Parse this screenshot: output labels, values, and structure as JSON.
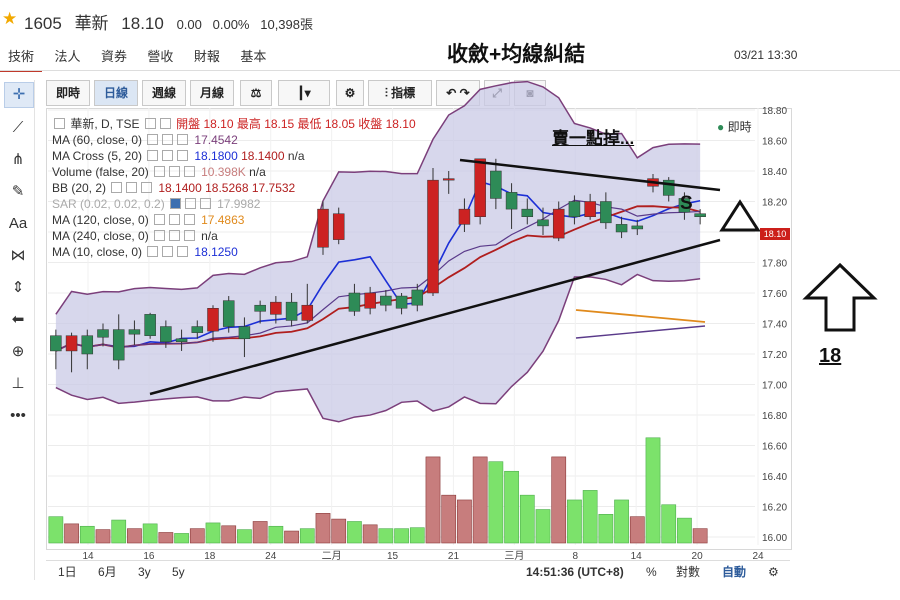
{
  "header": {
    "code": "1605",
    "name": "華新",
    "price": "18.10",
    "change": "0.00",
    "change_pct": "0.00%",
    "volume": "10,398張"
  },
  "nav": {
    "tabs": [
      "技術",
      "法人",
      "資券",
      "營收",
      "財報",
      "基本"
    ]
  },
  "annotation_title": "收斂+均線糾結",
  "datetime": "03/21 13:30",
  "toolbar": {
    "buttons": [
      "即時",
      "日線",
      "週線",
      "月線",
      "指標"
    ]
  },
  "live_label": "即時",
  "legend": {
    "main": "華新, D, TSE",
    "ohlc": "開盤 18.10 最高 18.15 最低 18.05 收盤 18.10",
    "ma60": {
      "label": "MA (60, close, 0)",
      "value": "17.4542"
    },
    "macross": {
      "label": "MA Cross (5, 20)",
      "v1": "18.1800",
      "v2": "18.1400",
      "v3": "n/a"
    },
    "volume": {
      "label": "Volume (false, 20)",
      "v1": "10.398K",
      "v2": "n/a"
    },
    "bb": {
      "label": "BB (20, 2)",
      "v1": "18.1400",
      "v2": "18.5268",
      "v3": "17.7532"
    },
    "sar": {
      "label": "SAR (0.02, 0.02, 0.2)",
      "value": "17.9982"
    },
    "ma120": {
      "label": "MA (120, close, 0)",
      "value": "17.4863"
    },
    "ma240": {
      "label": "MA (240, close, 0)",
      "value": "n/a"
    },
    "ma10": {
      "label": "MA (10, close, 0)",
      "value": "18.1250"
    }
  },
  "annotations": {
    "sell": "賣一點掉...",
    "s": "S",
    "target": "18"
  },
  "price_tag": "18.10",
  "bottom": {
    "ranges": [
      "1日",
      "6月",
      "3y",
      "5y"
    ],
    "time": "14:51:36 (UTC+8)",
    "pct": "%",
    "log": "對數",
    "auto": "自動"
  },
  "colors": {
    "up": "#cc2222",
    "down": "#2e8b57",
    "bb_band": "#7b3f7b",
    "ma_blue": "#1c2fd6",
    "ma_red": "#b01e1e",
    "vol_up": "#c77d7d",
    "vol_down": "#7ce26b"
  },
  "chart_data": {
    "type": "candlestick",
    "y_range": [
      16.0,
      18.8
    ],
    "y_ticks": [
      "18.80",
      "18.60",
      "18.40",
      "18.20",
      "18.00",
      "17.80",
      "17.60",
      "17.40",
      "17.20",
      "17.00",
      "16.80",
      "16.60",
      "16.40",
      "16.20",
      "16.00"
    ],
    "x_ticks": [
      "14",
      "16",
      "18",
      "24",
      "二月",
      "15",
      "21",
      "三月",
      "8",
      "14",
      "20",
      "24"
    ],
    "candles": [
      {
        "o": 17.32,
        "c": 17.22,
        "h": 17.36,
        "l": 17.1
      },
      {
        "o": 17.22,
        "c": 17.32,
        "h": 17.34,
        "l": 17.08
      },
      {
        "o": 17.32,
        "c": 17.2,
        "h": 17.36,
        "l": 17.1
      },
      {
        "o": 17.36,
        "c": 17.31,
        "h": 17.4,
        "l": 17.25
      },
      {
        "o": 17.36,
        "c": 17.16,
        "h": 17.46,
        "l": 17.1
      },
      {
        "o": 17.36,
        "c": 17.33,
        "h": 17.42,
        "l": 17.26
      },
      {
        "o": 17.46,
        "c": 17.32,
        "h": 17.47,
        "l": 17.3
      },
      {
        "o": 17.38,
        "c": 17.28,
        "h": 17.42,
        "l": 17.24
      },
      {
        "o": 17.3,
        "c": 17.28,
        "h": 17.36,
        "l": 17.22
      },
      {
        "o": 17.38,
        "c": 17.34,
        "h": 17.42,
        "l": 17.3
      },
      {
        "o": 17.35,
        "c": 17.5,
        "h": 17.52,
        "l": 17.28
      },
      {
        "o": 17.55,
        "c": 17.38,
        "h": 17.58,
        "l": 17.34
      },
      {
        "o": 17.38,
        "c": 17.3,
        "h": 17.44,
        "l": 17.18
      },
      {
        "o": 17.52,
        "c": 17.48,
        "h": 17.55,
        "l": 17.4
      },
      {
        "o": 17.46,
        "c": 17.54,
        "h": 17.58,
        "l": 17.4
      },
      {
        "o": 17.54,
        "c": 17.42,
        "h": 17.6,
        "l": 17.38
      },
      {
        "o": 17.42,
        "c": 17.52,
        "h": 17.66,
        "l": 17.4
      },
      {
        "o": 17.9,
        "c": 18.15,
        "h": 18.2,
        "l": 17.85
      },
      {
        "o": 17.95,
        "c": 18.12,
        "h": 18.16,
        "l": 17.92
      },
      {
        "o": 17.6,
        "c": 17.48,
        "h": 17.66,
        "l": 17.45
      },
      {
        "o": 17.5,
        "c": 17.6,
        "h": 17.64,
        "l": 17.46
      },
      {
        "o": 17.58,
        "c": 17.52,
        "h": 17.62,
        "l": 17.48
      },
      {
        "o": 17.58,
        "c": 17.5,
        "h": 17.6,
        "l": 17.46
      },
      {
        "o": 17.62,
        "c": 17.52,
        "h": 17.66,
        "l": 17.48
      },
      {
        "o": 17.6,
        "c": 18.34,
        "h": 18.42,
        "l": 17.58
      },
      {
        "o": 18.34,
        "c": 18.35,
        "h": 18.4,
        "l": 18.25
      },
      {
        "o": 18.05,
        "c": 18.15,
        "h": 18.22,
        "l": 18.0
      },
      {
        "o": 18.1,
        "c": 18.48,
        "h": 18.48,
        "l": 18.05
      },
      {
        "o": 18.4,
        "c": 18.22,
        "h": 18.48,
        "l": 18.15
      },
      {
        "o": 18.26,
        "c": 18.15,
        "h": 18.32,
        "l": 18.02
      },
      {
        "o": 18.15,
        "c": 18.1,
        "h": 18.22,
        "l": 18.05
      },
      {
        "o": 18.08,
        "c": 18.04,
        "h": 18.16,
        "l": 17.98
      },
      {
        "o": 17.96,
        "c": 18.15,
        "h": 18.2,
        "l": 17.94
      },
      {
        "o": 18.2,
        "c": 18.1,
        "h": 18.24,
        "l": 18.05
      },
      {
        "o": 18.1,
        "c": 18.2,
        "h": 18.25,
        "l": 18.08
      },
      {
        "o": 18.2,
        "c": 18.06,
        "h": 18.26,
        "l": 18.02
      },
      {
        "o": 18.05,
        "c": 18.0,
        "h": 18.1,
        "l": 17.96
      },
      {
        "o": 18.04,
        "c": 18.02,
        "h": 18.08,
        "l": 17.98
      },
      {
        "o": 18.3,
        "c": 18.35,
        "h": 18.38,
        "l": 18.26
      },
      {
        "o": 18.34,
        "c": 18.24,
        "h": 18.36,
        "l": 18.2
      },
      {
        "o": 18.22,
        "c": 18.13,
        "h": 18.26,
        "l": 18.08
      },
      {
        "o": 18.12,
        "c": 18.1,
        "h": 18.15,
        "l": 18.05
      }
    ],
    "volume": [
      {
        "v": 0.55,
        "up": false
      },
      {
        "v": 0.4,
        "up": true
      },
      {
        "v": 0.35,
        "up": false
      },
      {
        "v": 0.28,
        "up": true
      },
      {
        "v": 0.48,
        "up": false
      },
      {
        "v": 0.3,
        "up": true
      },
      {
        "v": 0.4,
        "up": false
      },
      {
        "v": 0.22,
        "up": true
      },
      {
        "v": 0.2,
        "up": false
      },
      {
        "v": 0.3,
        "up": true
      },
      {
        "v": 0.42,
        "up": false
      },
      {
        "v": 0.36,
        "up": true
      },
      {
        "v": 0.28,
        "up": false
      },
      {
        "v": 0.45,
        "up": true
      },
      {
        "v": 0.35,
        "up": false
      },
      {
        "v": 0.25,
        "up": true
      },
      {
        "v": 0.3,
        "up": false
      },
      {
        "v": 0.62,
        "up": true
      },
      {
        "v": 0.5,
        "up": true
      },
      {
        "v": 0.45,
        "up": false
      },
      {
        "v": 0.38,
        "up": true
      },
      {
        "v": 0.3,
        "up": false
      },
      {
        "v": 0.3,
        "up": false
      },
      {
        "v": 0.32,
        "up": false
      },
      {
        "v": 1.8,
        "up": true
      },
      {
        "v": 1.0,
        "up": true
      },
      {
        "v": 0.9,
        "up": true
      },
      {
        "v": 1.8,
        "up": true
      },
      {
        "v": 1.7,
        "up": false
      },
      {
        "v": 1.5,
        "up": false
      },
      {
        "v": 1.0,
        "up": false
      },
      {
        "v": 0.7,
        "up": false
      },
      {
        "v": 1.8,
        "up": true
      },
      {
        "v": 0.9,
        "up": false
      },
      {
        "v": 1.1,
        "up": false
      },
      {
        "v": 0.6,
        "up": false
      },
      {
        "v": 0.9,
        "up": false
      },
      {
        "v": 0.55,
        "up": true
      },
      {
        "v": 2.2,
        "up": false
      },
      {
        "v": 0.8,
        "up": false
      },
      {
        "v": 0.52,
        "up": false
      },
      {
        "v": 0.3,
        "up": true
      }
    ]
  }
}
